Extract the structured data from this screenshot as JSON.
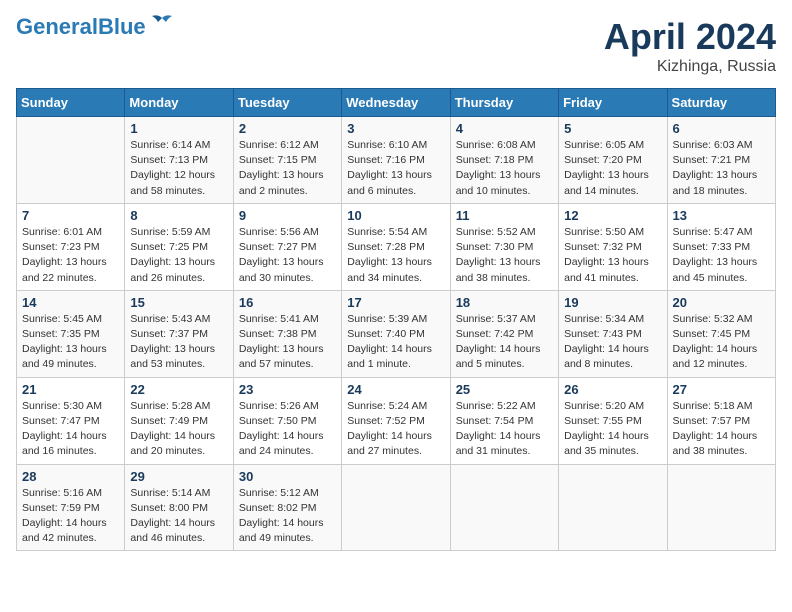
{
  "header": {
    "logo_line1": "General",
    "logo_line2": "Blue",
    "month": "April 2024",
    "location": "Kizhinga, Russia"
  },
  "days_of_week": [
    "Sunday",
    "Monday",
    "Tuesday",
    "Wednesday",
    "Thursday",
    "Friday",
    "Saturday"
  ],
  "weeks": [
    [
      {
        "day": null
      },
      {
        "day": "1",
        "sunrise": "6:14 AM",
        "sunset": "7:13 PM",
        "daylight": "12 hours and 58 minutes."
      },
      {
        "day": "2",
        "sunrise": "6:12 AM",
        "sunset": "7:15 PM",
        "daylight": "13 hours and 2 minutes."
      },
      {
        "day": "3",
        "sunrise": "6:10 AM",
        "sunset": "7:16 PM",
        "daylight": "13 hours and 6 minutes."
      },
      {
        "day": "4",
        "sunrise": "6:08 AM",
        "sunset": "7:18 PM",
        "daylight": "13 hours and 10 minutes."
      },
      {
        "day": "5",
        "sunrise": "6:05 AM",
        "sunset": "7:20 PM",
        "daylight": "13 hours and 14 minutes."
      },
      {
        "day": "6",
        "sunrise": "6:03 AM",
        "sunset": "7:21 PM",
        "daylight": "13 hours and 18 minutes."
      }
    ],
    [
      {
        "day": "7",
        "sunrise": "6:01 AM",
        "sunset": "7:23 PM",
        "daylight": "13 hours and 22 minutes."
      },
      {
        "day": "8",
        "sunrise": "5:59 AM",
        "sunset": "7:25 PM",
        "daylight": "13 hours and 26 minutes."
      },
      {
        "day": "9",
        "sunrise": "5:56 AM",
        "sunset": "7:27 PM",
        "daylight": "13 hours and 30 minutes."
      },
      {
        "day": "10",
        "sunrise": "5:54 AM",
        "sunset": "7:28 PM",
        "daylight": "13 hours and 34 minutes."
      },
      {
        "day": "11",
        "sunrise": "5:52 AM",
        "sunset": "7:30 PM",
        "daylight": "13 hours and 38 minutes."
      },
      {
        "day": "12",
        "sunrise": "5:50 AM",
        "sunset": "7:32 PM",
        "daylight": "13 hours and 41 minutes."
      },
      {
        "day": "13",
        "sunrise": "5:47 AM",
        "sunset": "7:33 PM",
        "daylight": "13 hours and 45 minutes."
      }
    ],
    [
      {
        "day": "14",
        "sunrise": "5:45 AM",
        "sunset": "7:35 PM",
        "daylight": "13 hours and 49 minutes."
      },
      {
        "day": "15",
        "sunrise": "5:43 AM",
        "sunset": "7:37 PM",
        "daylight": "13 hours and 53 minutes."
      },
      {
        "day": "16",
        "sunrise": "5:41 AM",
        "sunset": "7:38 PM",
        "daylight": "13 hours and 57 minutes."
      },
      {
        "day": "17",
        "sunrise": "5:39 AM",
        "sunset": "7:40 PM",
        "daylight": "14 hours and 1 minute."
      },
      {
        "day": "18",
        "sunrise": "5:37 AM",
        "sunset": "7:42 PM",
        "daylight": "14 hours and 5 minutes."
      },
      {
        "day": "19",
        "sunrise": "5:34 AM",
        "sunset": "7:43 PM",
        "daylight": "14 hours and 8 minutes."
      },
      {
        "day": "20",
        "sunrise": "5:32 AM",
        "sunset": "7:45 PM",
        "daylight": "14 hours and 12 minutes."
      }
    ],
    [
      {
        "day": "21",
        "sunrise": "5:30 AM",
        "sunset": "7:47 PM",
        "daylight": "14 hours and 16 minutes."
      },
      {
        "day": "22",
        "sunrise": "5:28 AM",
        "sunset": "7:49 PM",
        "daylight": "14 hours and 20 minutes."
      },
      {
        "day": "23",
        "sunrise": "5:26 AM",
        "sunset": "7:50 PM",
        "daylight": "14 hours and 24 minutes."
      },
      {
        "day": "24",
        "sunrise": "5:24 AM",
        "sunset": "7:52 PM",
        "daylight": "14 hours and 27 minutes."
      },
      {
        "day": "25",
        "sunrise": "5:22 AM",
        "sunset": "7:54 PM",
        "daylight": "14 hours and 31 minutes."
      },
      {
        "day": "26",
        "sunrise": "5:20 AM",
        "sunset": "7:55 PM",
        "daylight": "14 hours and 35 minutes."
      },
      {
        "day": "27",
        "sunrise": "5:18 AM",
        "sunset": "7:57 PM",
        "daylight": "14 hours and 38 minutes."
      }
    ],
    [
      {
        "day": "28",
        "sunrise": "5:16 AM",
        "sunset": "7:59 PM",
        "daylight": "14 hours and 42 minutes."
      },
      {
        "day": "29",
        "sunrise": "5:14 AM",
        "sunset": "8:00 PM",
        "daylight": "14 hours and 46 minutes."
      },
      {
        "day": "30",
        "sunrise": "5:12 AM",
        "sunset": "8:02 PM",
        "daylight": "14 hours and 49 minutes."
      },
      {
        "day": null
      },
      {
        "day": null
      },
      {
        "day": null
      },
      {
        "day": null
      }
    ]
  ]
}
